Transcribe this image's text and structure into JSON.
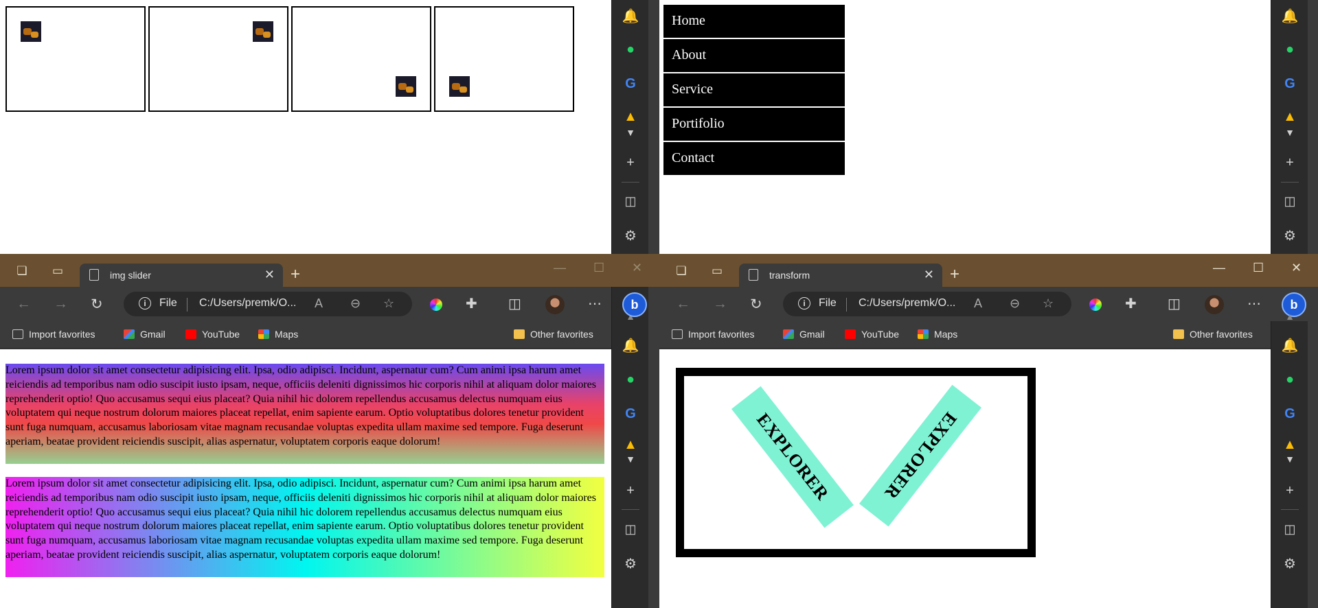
{
  "top_left": {
    "slide_images": [
      "img-1",
      "img-2",
      "img-3",
      "img-4"
    ]
  },
  "top_right": {
    "nav": [
      "Home",
      "About",
      "Service",
      "Portifolio",
      "Contact"
    ]
  },
  "sidebar": {
    "icons": [
      "bell-icon",
      "whatsapp-icon",
      "google-icon",
      "drive-icon",
      "chevron-down-icon",
      "plus-icon",
      "split-screen-icon",
      "settings-icon"
    ]
  },
  "browser_left": {
    "tab_title": "img slider",
    "file_label": "File",
    "url": "C:/Users/premk/O...",
    "favorites": {
      "import": "Import favorites",
      "gmail": "Gmail",
      "youtube": "YouTube",
      "maps": "Maps",
      "other": "Other favorites"
    },
    "paragraph_1": "Lorem ipsum dolor sit amet consectetur adipisicing elit. Ipsa, odio adipisci. Incidunt, aspernatur cum? Cum animi ipsa harum amet reiciendis ad temporibus nam odio suscipit iusto ipsam, neque, officiis deleniti dignissimos hic corporis nihil at aliquam dolor maiores reprehenderit optio! Quo accusamus sequi eius placeat? Quia nihil hic dolorem repellendus accusamus delectus numquam eius voluptatem qui neque nostrum dolorum maiores placeat repellat, enim sapiente earum. Optio voluptatibus dolores tenetur provident sunt fuga numquam, accusamus laboriosam vitae magnam recusandae voluptas expedita ullam maxime sed tempore. Fuga deserunt aperiam, beatae provident reiciendis suscipit, alias aspernatur, voluptatem corporis eaque dolorum!",
    "paragraph_2": "Lorem ipsum dolor sit amet consectetur adipisicing elit. Ipsa, odio adipisci. Incidunt, aspernatur cum? Cum animi ipsa harum amet reiciendis ad temporibus nam odio suscipit iusto ipsam, neque, officiis deleniti dignissimos hic corporis nihil at aliquam dolor maiores reprehenderit optio! Quo accusamus sequi eius placeat? Quia nihil hic dolorem repellendus accusamus delectus numquam eius voluptatem qui neque nostrum dolorum maiores placeat repellat, enim sapiente earum. Optio voluptatibus dolores tenetur provident sunt fuga numquam, accusamus laboriosam vitae magnam recusandae voluptas expedita ullam maxime sed tempore. Fuga deserunt aperiam, beatae provident reiciendis suscipit, alias aspernatur, voluptatem corporis eaque dolorum!"
  },
  "browser_right": {
    "tab_title": "transform",
    "file_label": "File",
    "url": "C:/Users/premk/O...",
    "favorites": {
      "import": "Import favorites",
      "gmail": "Gmail",
      "youtube": "YouTube",
      "maps": "Maps",
      "other": "Other favorites"
    },
    "explorer_left": "EXPLORER",
    "explorer_right": "EXPLORER"
  },
  "colors": {
    "titlebar": "#6a5030",
    "chrome": "#3b3b3b",
    "explorer_bg": "#7ff2d4"
  }
}
